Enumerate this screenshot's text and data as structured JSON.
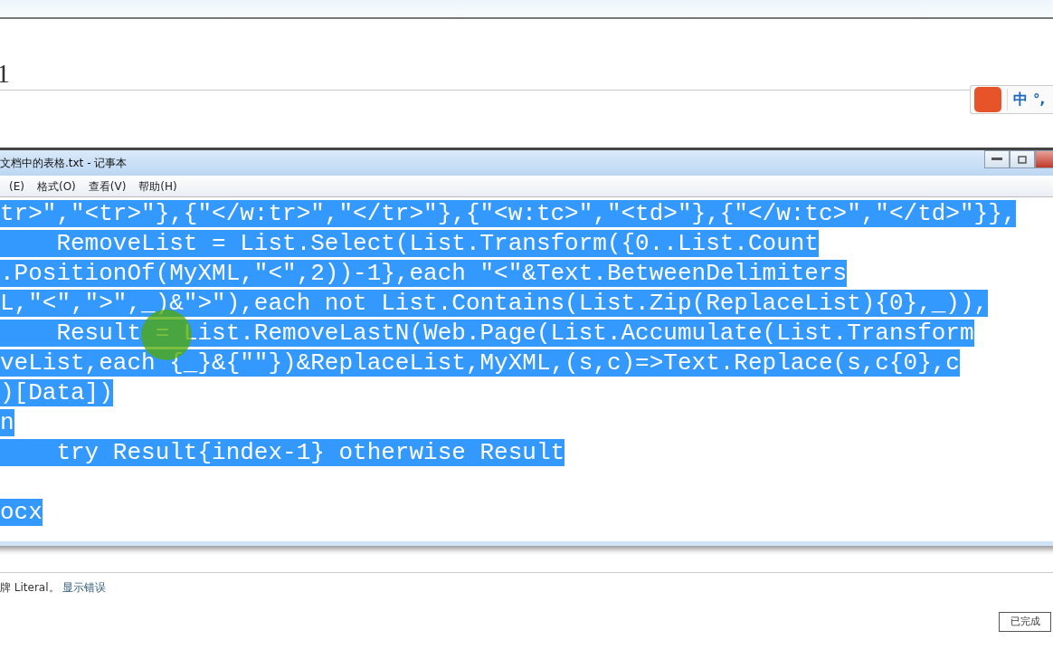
{
  "page": {
    "heading": "1"
  },
  "ime_toolbar": {
    "mode": "中",
    "punctuation": "°,"
  },
  "notepad": {
    "title": "文档中的表格.txt - 记事本",
    "menu": [
      "(E)",
      "格式(O)",
      "查看(V)",
      "帮助(H)"
    ],
    "blocks": [
      {
        "lines": [
          {
            "text": "tr>\",\"<tr>\"},{\"</w:tr>\",\"</tr>\"},{\"<w:tc>\",\"<td>\"},{\"</w:tc>\",\"</td>\"}},",
            "selected": true
          },
          {
            "text": "    RemoveList = List.Select(List.Transform({0..List.Count",
            "selected": true
          },
          {
            "text": ".PositionOf(MyXML,\"<\",2))-1},each \"<\"&Text.BetweenDelimiters",
            "selected": true
          },
          {
            "text": "L,\"<\",\">\",_)&\">\"),each not List.Contains(List.Zip(ReplaceList){0},_)),",
            "selected": true
          },
          {
            "text": "    Result = List.RemoveLastN(Web.Page(List.Accumulate(List.Transform",
            "selected": true
          },
          {
            "text": "veList,each {_}&{\"\"})&ReplaceList,MyXML,(s,c)=>Text.Replace(s,c{0},c",
            "selected": true
          },
          {
            "text": ")[Data])",
            "selected": true
          },
          {
            "text": "n",
            "selected": true
          },
          {
            "text": "    try Result{index-1} otherwise Result",
            "selected": true
          }
        ]
      },
      {
        "lines": [
          {
            "text": "ocx",
            "selected": true
          }
        ]
      }
    ]
  },
  "footer": {
    "note": "牌 Literal。",
    "link": "显示错误",
    "button": "已完成"
  }
}
